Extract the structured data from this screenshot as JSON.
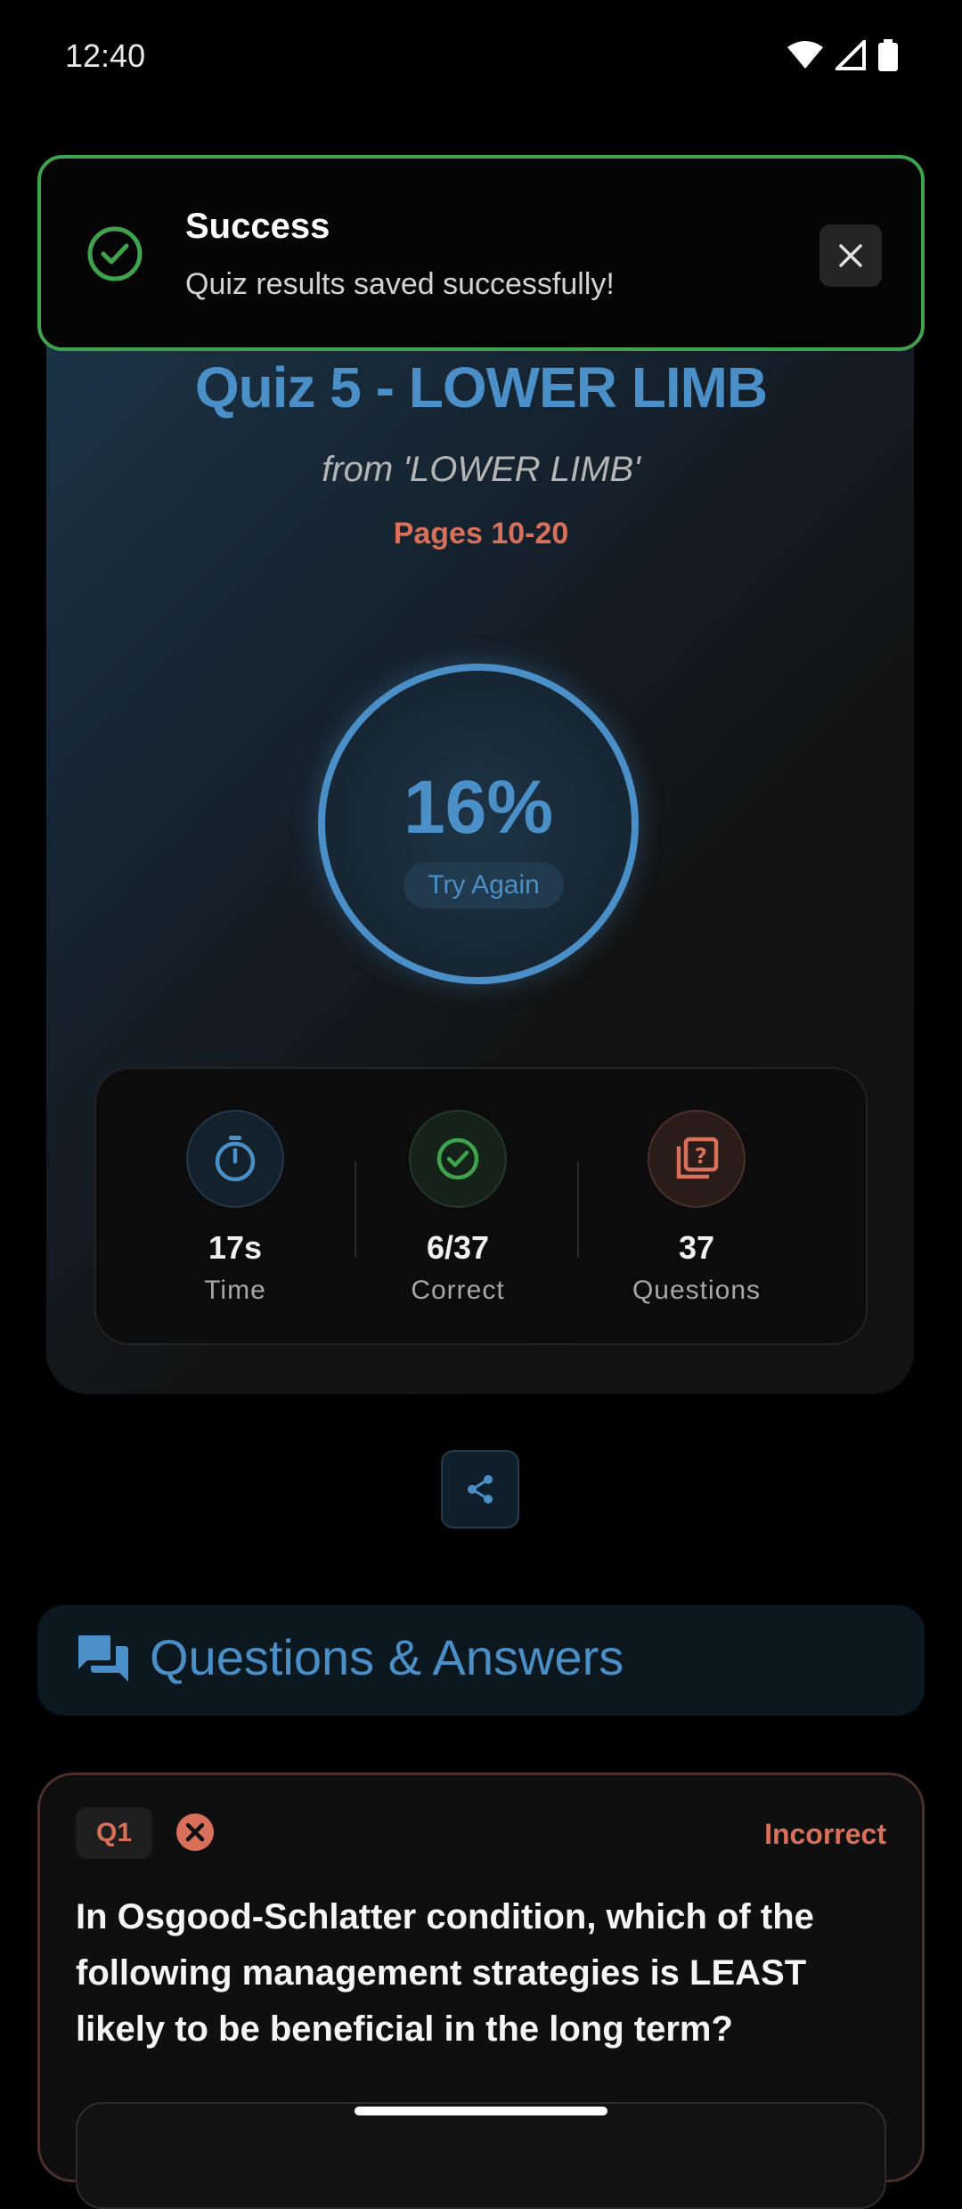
{
  "status_bar": {
    "time": "12:40"
  },
  "toast": {
    "title": "Success",
    "message": "Quiz results saved successfully!",
    "accent": "#3fa34d"
  },
  "quiz": {
    "title": "Quiz 5 - LOWER LIMB",
    "source": "from 'LOWER LIMB'",
    "pages": "Pages 10-20",
    "score": "16%",
    "score_fraction": 0.16,
    "try_again_label": "Try Again"
  },
  "stats": [
    {
      "icon": "stopwatch-icon",
      "value": "17s",
      "label": "Time"
    },
    {
      "icon": "check-circle-icon",
      "value": "6/37",
      "label": "Correct"
    },
    {
      "icon": "question-stack-icon",
      "value": "37",
      "label": "Questions"
    }
  ],
  "qa": {
    "title": "Questions & Answers"
  },
  "questions": [
    {
      "number": "Q1",
      "status": "Incorrect",
      "text": "In Osgood-Schlatter condition, which of the following management strategies is LEAST likely to be beneficial in the long term?"
    }
  ],
  "colors": {
    "accent_blue": "#4a8fc7",
    "accent_red": "#d9705a",
    "success_green": "#3fa34d"
  }
}
